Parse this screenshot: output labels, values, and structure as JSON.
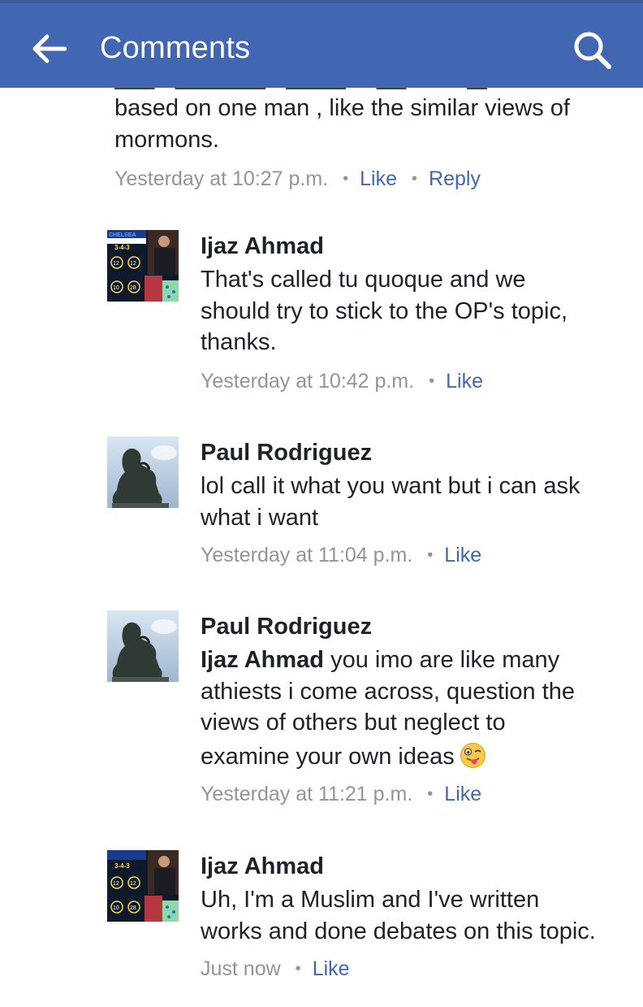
{
  "header": {
    "title": "Comments"
  },
  "partial_comment": {
    "text_lines": [
      "based on one man , like the similar views of",
      "mormons."
    ],
    "time": "Yesterday at 10:27 p.m.",
    "like": "Like",
    "reply": "Reply"
  },
  "comments": [
    {
      "author": "Ijaz Ahmad",
      "lines": [
        "That's called tu quoque and we",
        "should try to stick to the OP's topic,",
        "thanks."
      ],
      "time": "Yesterday at 10:42 p.m.",
      "like": "Like",
      "avatar": {
        "text_top": "CHELSEA",
        "text_small": "IN THE PREMIER LEAGUE SINCE SWITCHING TO",
        "formation": "3-4-3",
        "num1": "12",
        "num2": "12",
        "num3": "10",
        "num4": "28"
      }
    },
    {
      "author": "Paul Rodriguez",
      "lines": [
        "lol call it what you want but i can ask",
        "what i want"
      ],
      "time": "Yesterday at 11:04 p.m.",
      "like": "Like"
    },
    {
      "author": "Paul Rodriguez",
      "mention": "Ijaz Ahmad",
      "first_line_rest": " you imo are like many",
      "lines": [
        "athiests i come across, question the",
        "views of others but neglect to"
      ],
      "last_line": "examine your own ideas",
      "emoji": "winking-tongue-emoji",
      "time": "Yesterday at 11:21 p.m.",
      "like": "Like"
    },
    {
      "author": "Ijaz Ahmad",
      "lines": [
        "Uh, I'm a Muslim and I've written",
        "works and done debates on this topic."
      ],
      "time": "Just now",
      "like": "Like",
      "avatar": {
        "formation": "3-4-3",
        "num1": "12",
        "num2": "12",
        "num3": "10",
        "num4": "28"
      }
    }
  ],
  "colors": {
    "header": "#4267b2",
    "link": "#4267b2",
    "meta": "#90949c",
    "text": "#1d2129"
  }
}
